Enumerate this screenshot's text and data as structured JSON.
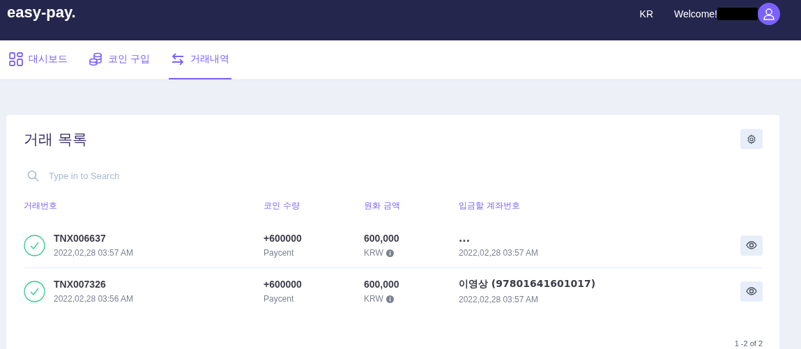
{
  "header": {
    "logo": "easy-pay.",
    "language": "KR",
    "welcome": "Welcome!"
  },
  "tabs": [
    {
      "label": "대시보드",
      "kind": "grid",
      "selected": false
    },
    {
      "label": "코인 구입",
      "kind": "coins",
      "selected": false
    },
    {
      "label": "거래내역",
      "kind": "swap",
      "selected": true
    }
  ],
  "card": {
    "title": "거래 목록",
    "search": {
      "placeholder": "Type in to Search"
    },
    "columns": [
      "거래번호",
      "코인 수량",
      "원화 금액",
      "입금할 계좌번호"
    ],
    "rows": [
      {
        "completed": true,
        "id": "TNX006637",
        "date": "2022,02,28 03:57 AM",
        "amount": "+600000",
        "coin": "Paycent",
        "krw": "600,000",
        "currency": "KRW",
        "account": "...",
        "account_date": "2022,02,28 03:57 AM"
      },
      {
        "completed": true,
        "id": "TNX007326",
        "date": "2022,02,28 03:56 AM",
        "amount": "+600000",
        "coin": "Paycent",
        "krw": "600,000",
        "currency": "KRW",
        "account": "이영상 (97801641601017)",
        "account_date": "2022,02,28 03:57 AM"
      }
    ],
    "pagination": "1 -2 of 2"
  }
}
